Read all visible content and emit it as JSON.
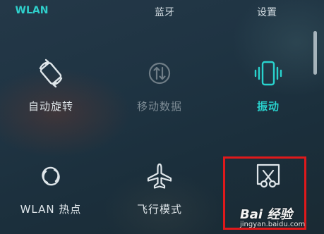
{
  "top_row": {
    "wlan": "WLAN",
    "bluetooth": "蓝牙",
    "settings": "设置"
  },
  "tiles": [
    {
      "label": "自动旋转",
      "icon": "rotate-icon",
      "state": "on"
    },
    {
      "label": "移动数据",
      "icon": "mobile-data-icon",
      "state": "disabled"
    },
    {
      "label": "振动",
      "icon": "vibrate-icon",
      "state": "active"
    },
    {
      "label": "WLAN 热点",
      "icon": "hotspot-icon",
      "state": "on"
    },
    {
      "label": "飞行模式",
      "icon": "airplane-icon",
      "state": "on"
    },
    {
      "label": "",
      "icon": "screenshot-icon",
      "state": "on"
    }
  ],
  "watermark": {
    "brand": "Bai 经验",
    "url": "jingyan.baidu.com"
  },
  "colors": {
    "accent": "#29d3ce",
    "highlight": "#e0191b",
    "text": "#dfe6ea",
    "dim": "#7d8b94"
  }
}
